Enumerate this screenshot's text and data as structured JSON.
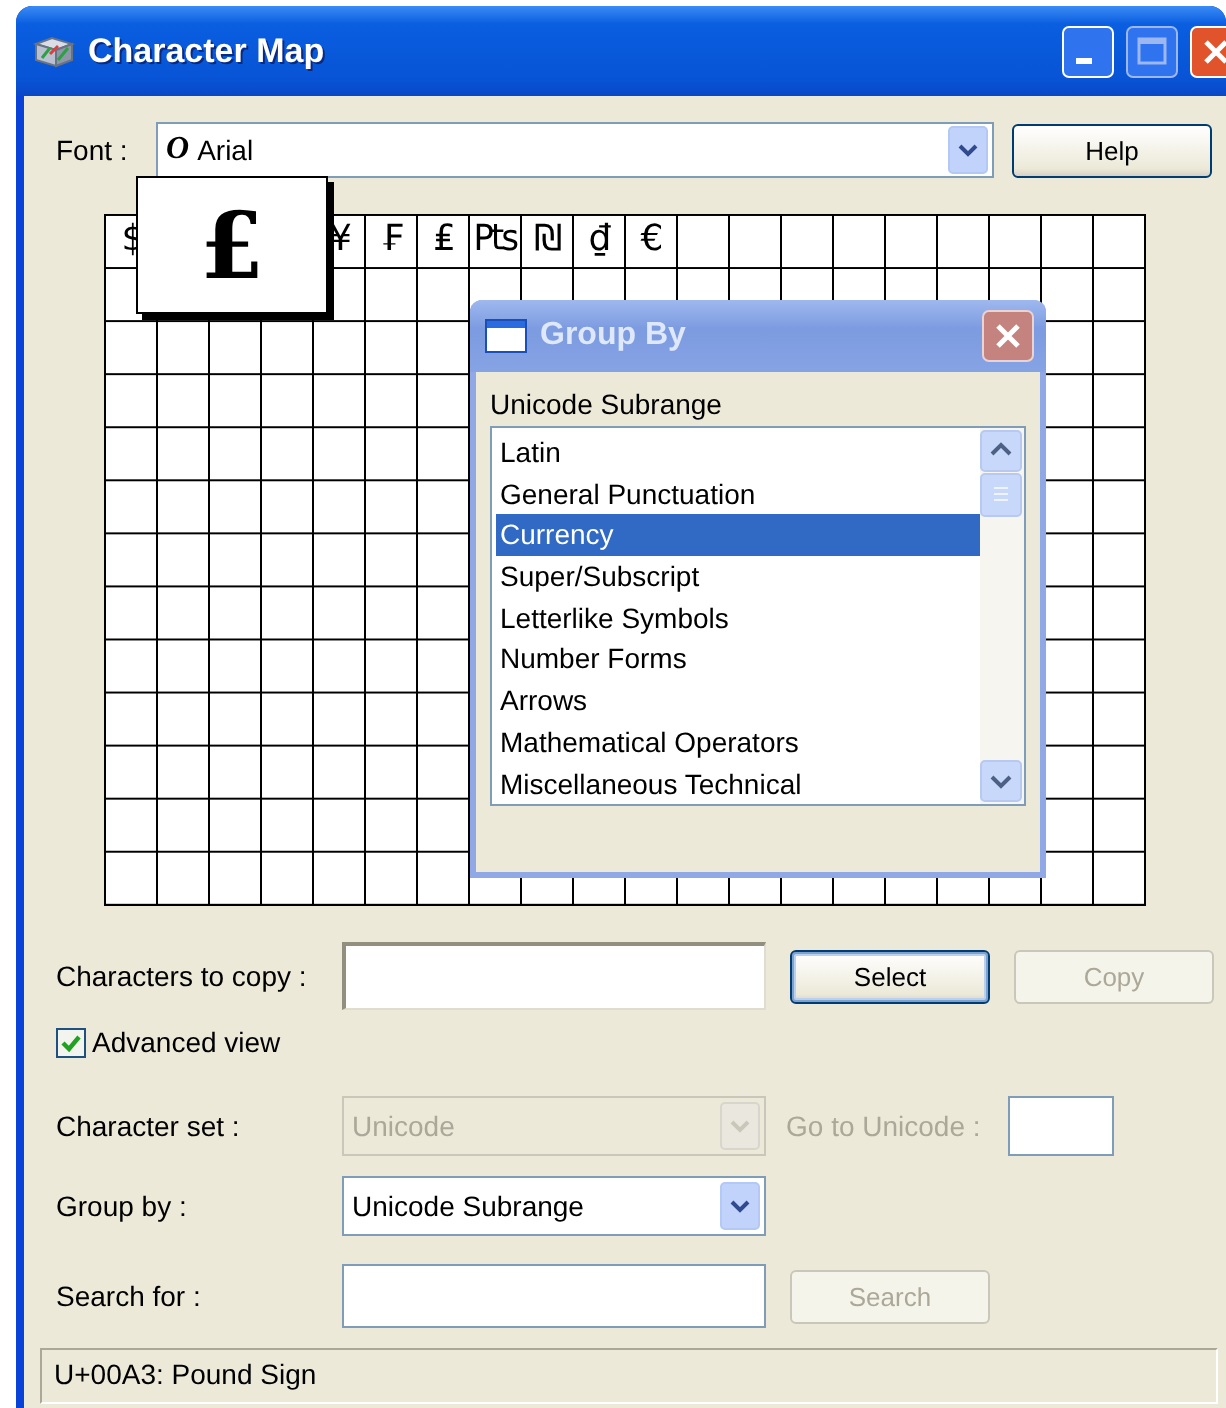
{
  "window": {
    "title": "Character Map"
  },
  "font": {
    "label": "Font :",
    "icon": "O",
    "value": "Arial"
  },
  "help_button": {
    "label": "Help"
  },
  "grid": {
    "cells": [
      {
        "kind": "char",
        "char": "$"
      },
      {
        "kind": "covered"
      },
      {
        "kind": "covered"
      },
      {
        "kind": "covered"
      },
      {
        "kind": "char",
        "char": "¥"
      },
      {
        "kind": "char",
        "char": "₣"
      },
      {
        "kind": "char",
        "char": "₤"
      },
      {
        "kind": "char",
        "char": "₧"
      },
      {
        "kind": "char",
        "char": "₪"
      },
      {
        "kind": "char",
        "char": "₫"
      },
      {
        "kind": "char",
        "char": "€"
      }
    ]
  },
  "magnifier": {
    "char": "£"
  },
  "characters_to_copy": {
    "label": "Characters to copy :"
  },
  "select_button": {
    "label": "Select",
    "disabled": false
  },
  "copy_button": {
    "label": "Copy",
    "disabled": true
  },
  "advanced_view": {
    "label": "Advanced view",
    "checked": true
  },
  "character_set": {
    "label": "Character set :",
    "value": "Unicode",
    "disabled": true
  },
  "go_to_unicode": {
    "label": "Go to Unicode :",
    "disabled": true
  },
  "group_by": {
    "label": "Group by :",
    "value": "Unicode Subrange",
    "disabled": false
  },
  "search_for": {
    "label": "Search for :"
  },
  "search_button": {
    "label": "Search",
    "disabled": true
  },
  "status_bar": {
    "text": "U+00A3: Pound Sign"
  },
  "group_by_dialog": {
    "title": "Group By",
    "label": "Unicode Subrange",
    "items": [
      {
        "label": "Latin",
        "selected": false
      },
      {
        "label": "General Punctuation",
        "selected": false
      },
      {
        "label": "Currency",
        "selected": true
      },
      {
        "label": "Super/Subscript",
        "selected": false
      },
      {
        "label": "Letterlike Symbols",
        "selected": false
      },
      {
        "label": "Number Forms",
        "selected": false
      },
      {
        "label": "Arrows",
        "selected": false
      },
      {
        "label": "Mathematical Operators",
        "selected": false
      },
      {
        "label": "Miscellaneous Technical",
        "selected": false
      }
    ]
  }
}
